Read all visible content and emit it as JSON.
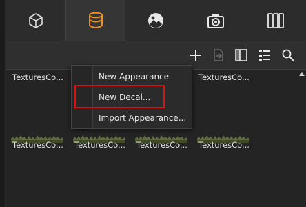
{
  "tabs": [
    {
      "name": "cube-icon",
      "active": false
    },
    {
      "name": "database-icon",
      "active": true
    },
    {
      "name": "image-icon",
      "active": false
    },
    {
      "name": "camera-icon",
      "active": false
    },
    {
      "name": "columns-icon",
      "active": false
    }
  ],
  "toolbar": {
    "icons": [
      "plus-icon",
      "export-icon",
      "panel-icon",
      "grid-view-icon",
      "search-icon"
    ]
  },
  "thumbnails": [
    {
      "label": "TexturesCo..."
    },
    {
      "label": "TexturesCo..."
    },
    {
      "label": "TexturesCo..."
    },
    {
      "label": "TexturesCo..."
    },
    {
      "label": "TexturesCo..."
    },
    {
      "label": "TexturesCo..."
    }
  ],
  "context_menu": {
    "items": [
      "New Appearance",
      "New Decal...",
      "Import Appearance..."
    ]
  },
  "colors": {
    "accent": "#f0901e",
    "highlight": "#e01010"
  }
}
